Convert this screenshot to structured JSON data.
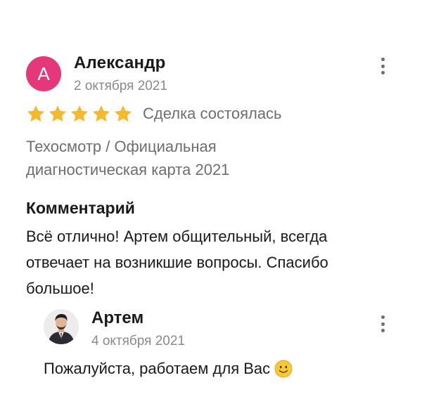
{
  "review": {
    "avatar_letter": "А",
    "author": "Александр",
    "date": "2 октября 2021",
    "rating": 5,
    "deal_status": "Сделка состоялась",
    "service_line1": "Техосмотр / Официальная",
    "service_line2": "диагностическая карта 2021",
    "comment_title": "Комментарий",
    "comment_text": "Всё отлично! Артем общительный, всегда отвечает на возникшие вопросы. Спасибо большое!"
  },
  "reply": {
    "author": "Артем",
    "date": "4 октября 2021",
    "text": "Пожалуйста, работаем для Вас"
  },
  "colors": {
    "avatar_bg": "#e4387b",
    "star": "#f5b82e",
    "muted_text": "#6e6e6e"
  },
  "icons": {
    "star": "star-icon",
    "menu": "more-vertical-icon",
    "emoji": "slightly-smiling-face-icon"
  }
}
